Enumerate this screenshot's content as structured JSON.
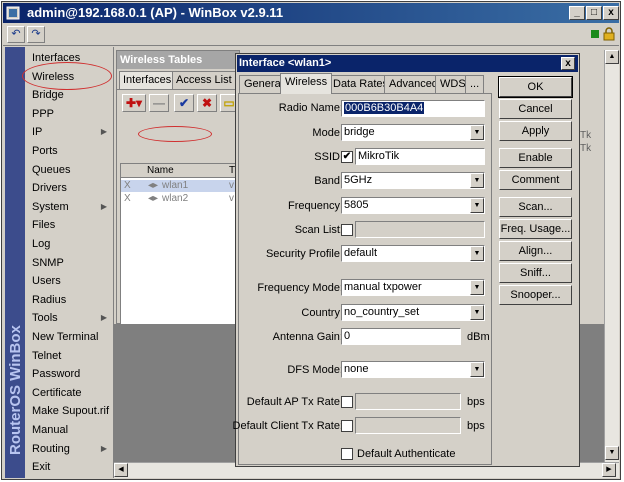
{
  "window": {
    "title": "admin@192.168.0.1 (AP) - WinBox v2.9.11",
    "brand": "RouterOS WinBox"
  },
  "menu": [
    {
      "label": "Interfaces",
      "sub": false
    },
    {
      "label": "Wireless",
      "sub": false
    },
    {
      "label": "Bridge",
      "sub": false
    },
    {
      "label": "PPP",
      "sub": false
    },
    {
      "label": "IP",
      "sub": true
    },
    {
      "label": "Ports",
      "sub": false
    },
    {
      "label": "Queues",
      "sub": false
    },
    {
      "label": "Drivers",
      "sub": false
    },
    {
      "label": "System",
      "sub": true
    },
    {
      "label": "Files",
      "sub": false
    },
    {
      "label": "Log",
      "sub": false
    },
    {
      "label": "SNMP",
      "sub": false
    },
    {
      "label": "Users",
      "sub": false
    },
    {
      "label": "Radius",
      "sub": false
    },
    {
      "label": "Tools",
      "sub": true
    },
    {
      "label": "New Terminal",
      "sub": false
    },
    {
      "label": "Telnet",
      "sub": false
    },
    {
      "label": "Password",
      "sub": false
    },
    {
      "label": "Certificate",
      "sub": false
    },
    {
      "label": "Make Supout.rif",
      "sub": false
    },
    {
      "label": "Manual",
      "sub": false
    },
    {
      "label": "Routing",
      "sub": true
    },
    {
      "label": "Exit",
      "sub": false
    }
  ],
  "wireless_tables": {
    "title": "Wireless Tables",
    "tabs": [
      "Interfaces",
      "Access List"
    ],
    "column_name": "Name",
    "column_t": "T",
    "rows": [
      {
        "flag": "X",
        "name": "wlan1",
        "t": "v"
      },
      {
        "flag": "X",
        "name": "wlan2",
        "t": "v"
      }
    ]
  },
  "dialog": {
    "title": "Interface <wlan1>",
    "close": "x",
    "tabs": [
      "General",
      "Wireless",
      "Data Rates",
      "Advanced",
      "WDS",
      "..."
    ],
    "fields": {
      "radio_name": {
        "label": "Radio Name:",
        "value": "000B6B30B4A4"
      },
      "mode": {
        "label": "Mode:",
        "value": "bridge"
      },
      "ssid": {
        "label": "SSID:",
        "value": "MikroTik",
        "checked": true
      },
      "band": {
        "label": "Band:",
        "value": "5GHz"
      },
      "frequency": {
        "label": "Frequency:",
        "value": "5805"
      },
      "scan_list": {
        "label": "Scan List:",
        "value": ""
      },
      "security_profile": {
        "label": "Security Profile:",
        "value": "default"
      },
      "frequency_mode": {
        "label": "Frequency Mode:",
        "value": "manual txpower"
      },
      "country": {
        "label": "Country:",
        "value": "no_country_set"
      },
      "antenna_gain": {
        "label": "Antenna Gain:",
        "value": "0",
        "unit": "dBm"
      },
      "dfs_mode": {
        "label": "DFS Mode:",
        "value": "none"
      },
      "default_ap_tx_rate": {
        "label": "Default AP Tx Rate:",
        "unit": "bps"
      },
      "default_client_tx_rate": {
        "label": "Default Client Tx Rate:",
        "unit": "bps"
      },
      "default_authenticate": {
        "label": "Default Authenticate"
      }
    },
    "buttons": [
      "OK",
      "Cancel",
      "Apply",
      "Enable",
      "Comment",
      "Scan...",
      "Freq. Usage...",
      "Align...",
      "Sniff...",
      "Snooper..."
    ]
  },
  "background_list_fragments": [
    "Tk",
    "Tk"
  ],
  "colors": {
    "title_active": "#0a246a",
    "annotation_ring": "#d03030"
  }
}
